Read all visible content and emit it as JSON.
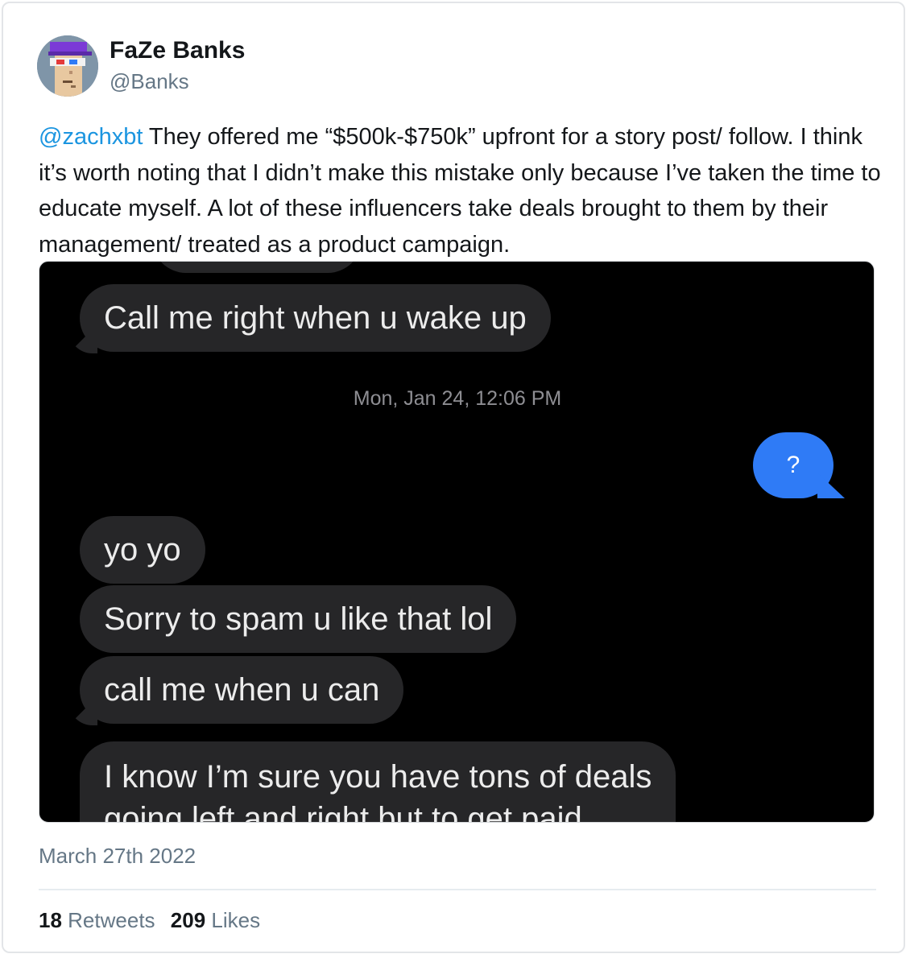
{
  "author": {
    "name": "FaZe Banks",
    "handle": "@Banks"
  },
  "tweet": {
    "mention": "@zachxbt",
    "body": " They offered me “$500k-$750k” upfront for a story post/ follow. I think it’s worth noting that I didn’t make this mistake only because I’ve taken the time to educate myself. A lot of these influencers take deals brought to them by their management/ treated as a product campaign."
  },
  "media": {
    "messages": {
      "m1": "Call me right when u wake up",
      "timestamp": "Mon, Jan 24, 12:06 PM",
      "sent": "?",
      "m2": "yo yo",
      "m3": "Sorry to spam u like that lol",
      "m4": "call me when u can",
      "m5_line1": "I know I’m sure you have tons of deals",
      "m5_line2": "going left and right but to get paid"
    },
    "colors": {
      "incoming": "#262628",
      "outgoing": "#2f7bf6",
      "background": "#000000"
    }
  },
  "footer": {
    "date": "March 27th 2022",
    "retweets_count": "18",
    "retweets_label": "Retweets",
    "likes_count": "209",
    "likes_label": "Likes"
  },
  "colors": {
    "link": "#1b95e0",
    "secondary_text": "#657786"
  }
}
